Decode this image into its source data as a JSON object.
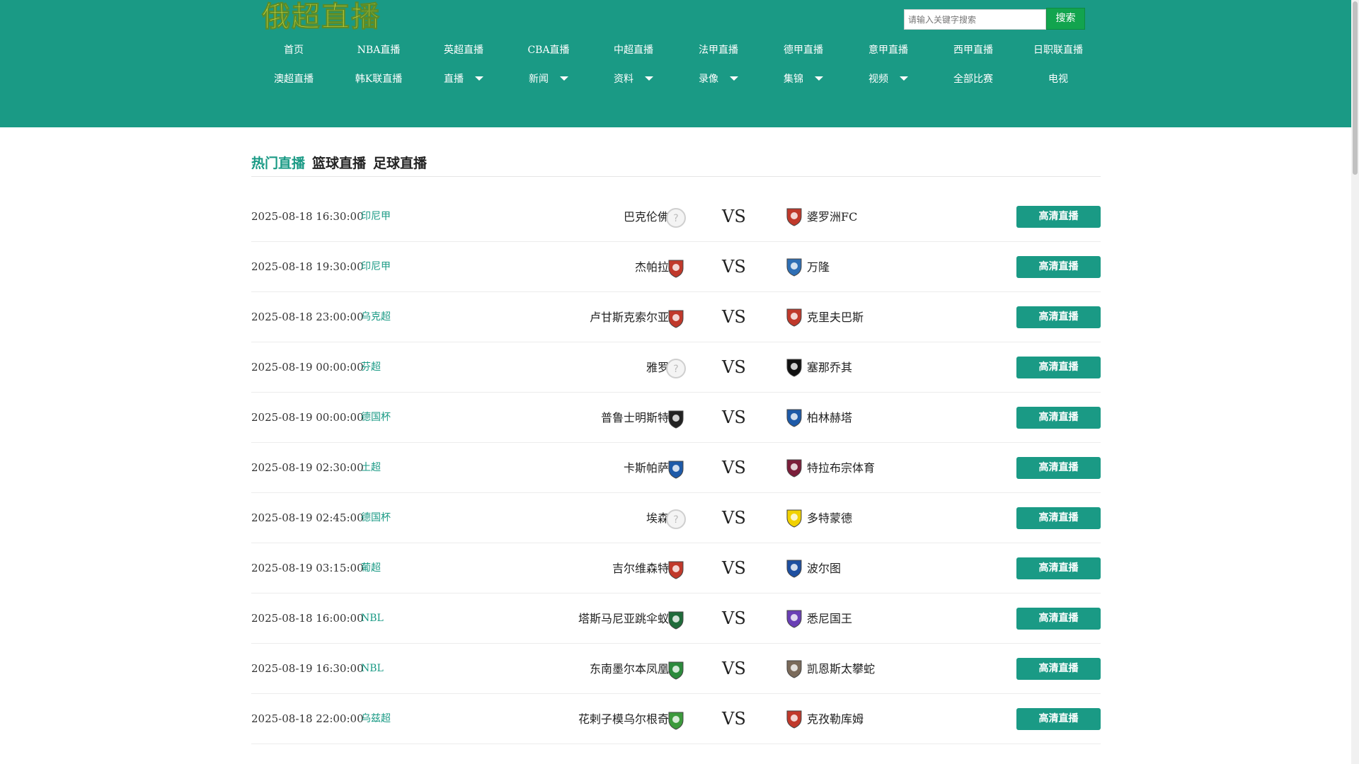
{
  "header": {
    "logo_text": "俄超直播",
    "search_placeholder": "请输入关键字搜索",
    "search_button": "搜索",
    "nav_row1": [
      "首页",
      "NBA直播",
      "英超直播",
      "CBA直播",
      "中超直播",
      "法甲直播",
      "德甲直播",
      "意甲直播",
      "西甲直播",
      "日职联直播"
    ],
    "nav_row2": [
      {
        "label": "澳超直播",
        "dropdown": false
      },
      {
        "label": "韩K联直播",
        "dropdown": false
      },
      {
        "label": "直播",
        "dropdown": true
      },
      {
        "label": "新闻",
        "dropdown": true
      },
      {
        "label": "资料",
        "dropdown": true
      },
      {
        "label": "录像",
        "dropdown": true
      },
      {
        "label": "集锦",
        "dropdown": true
      },
      {
        "label": "视频",
        "dropdown": true
      },
      {
        "label": "全部比赛",
        "dropdown": false
      },
      {
        "label": "电视",
        "dropdown": false
      }
    ]
  },
  "tabs": [
    "热门直播",
    "篮球直播",
    "足球直播"
  ],
  "vs_label": "VS",
  "watch_label": "高清直播",
  "matches": [
    {
      "time": "2025-08-18 16:30:00",
      "league": "印尼甲",
      "home": "巴克伦佛",
      "away": "婆罗洲FC",
      "home_icon": "placeholder-badge-icon",
      "away_icon": "bear-crest-icon",
      "home_color": "#d0d0d0",
      "away_color": "#c0392b"
    },
    {
      "time": "2025-08-18 19:30:00",
      "league": "印尼甲",
      "home": "杰帕拉",
      "away": "万隆",
      "home_icon": "red-shield-icon",
      "away_icon": "blue-shield-icon",
      "home_color": "#c0392b",
      "away_color": "#2f6fb5"
    },
    {
      "time": "2025-08-18 23:00:00",
      "league": "乌克超",
      "home": "卢甘斯克索尔亚",
      "away": "克里夫巴斯",
      "home_icon": "red-white-crest-icon",
      "away_icon": "red-ball-crest-icon",
      "home_color": "#c0392b",
      "away_color": "#c0392b"
    },
    {
      "time": "2025-08-19 00:00:00",
      "league": "芬超",
      "home": "雅罗",
      "away": "塞那乔其",
      "home_icon": "placeholder-badge-icon",
      "away_icon": "sjk-crest-icon",
      "home_color": "#d0d0d0",
      "away_color": "#111111"
    },
    {
      "time": "2025-08-19 00:00:00",
      "league": "德国杯",
      "home": "普鲁士明斯特",
      "away": "柏林赫塔",
      "home_icon": "eagle-crest-icon",
      "away_icon": "blue-flag-crest-icon",
      "home_color": "#222222",
      "away_color": "#1e5aa8"
    },
    {
      "time": "2025-08-19 02:30:00",
      "league": "土超",
      "home": "卡斯帕萨",
      "away": "特拉布宗体育",
      "home_icon": "blue-round-crest-icon",
      "away_icon": "maroon-blue-crest-icon",
      "home_color": "#1e5aa8",
      "away_color": "#7b1e3a"
    },
    {
      "time": "2025-08-19 02:45:00",
      "league": "德国杯",
      "home": "埃森",
      "away": "多特蒙德",
      "home_icon": "placeholder-badge-icon",
      "away_icon": "bvb-crest-icon",
      "home_color": "#d0d0d0",
      "away_color": "#f1d100"
    },
    {
      "time": "2025-08-19 03:15:00",
      "league": "葡超",
      "home": "吉尔维森特",
      "away": "波尔图",
      "home_icon": "red-blue-crest-icon",
      "away_icon": "porto-crest-icon",
      "home_color": "#c0392b",
      "away_color": "#1e4fa0"
    },
    {
      "time": "2025-08-18 16:00:00",
      "league": "NBL",
      "home": "塔斯马尼亚跳伞蚁",
      "away": "悉尼国王",
      "home_icon": "green-shield-icon",
      "away_icon": "kings-logo-icon",
      "home_color": "#1f6b3a",
      "away_color": "#6a3fb5"
    },
    {
      "time": "2025-08-19 16:30:00",
      "league": "NBL",
      "home": "东南墨尔本凤凰",
      "away": "凯恩斯太攀蛇",
      "home_icon": "phoenix-logo-icon",
      "away_icon": "taipans-logo-icon",
      "home_color": "#2c8a3c",
      "away_color": "#7a6a5a"
    },
    {
      "time": "2025-08-18 22:00:00",
      "league": "乌兹超",
      "home": "花剌子模乌尔根奇",
      "away": "克孜勒库姆",
      "home_icon": "green-yellow-crest-icon",
      "away_icon": "red-yellow-crest-icon",
      "home_color": "#3c9a3c",
      "away_color": "#c0392b"
    }
  ]
}
